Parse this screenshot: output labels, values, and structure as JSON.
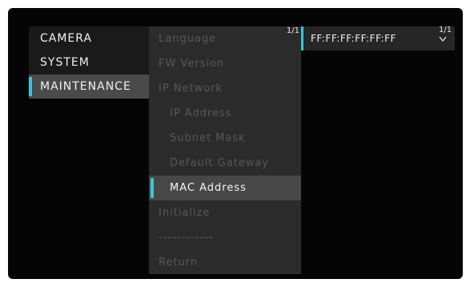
{
  "main_menu": {
    "items": [
      {
        "label": "CAMERA"
      },
      {
        "label": "SYSTEM"
      },
      {
        "label": "MAINTENANCE"
      }
    ],
    "selected_index": 2
  },
  "sub_menu": {
    "page_indicator": "1/1",
    "items": [
      {
        "label": "Language"
      },
      {
        "label": "FW Version"
      },
      {
        "label": "IP Network"
      },
      {
        "label": "IP Address"
      },
      {
        "label": "Subnet Mask"
      },
      {
        "label": "Default Gateway"
      },
      {
        "label": "MAC Address"
      },
      {
        "label": "Initialize"
      },
      {
        "label": "------------"
      },
      {
        "label": "Return"
      }
    ],
    "selected_index": 6
  },
  "value_panel": {
    "value": "FF:FF:FF:FF:FF:FF",
    "page_indicator": "1/1",
    "scroll_icon": "chevron-down-icon"
  },
  "colors": {
    "accent": "#3cc4dc",
    "background": "#050505",
    "selected_row": "#474747",
    "disabled_text": "#585858"
  }
}
